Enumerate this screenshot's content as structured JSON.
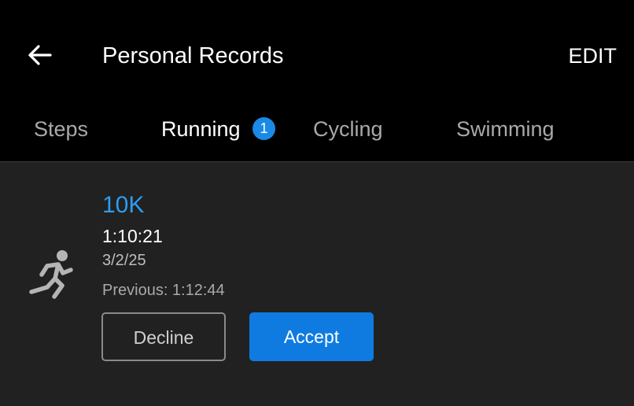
{
  "header": {
    "back_icon": "arrow-left-icon",
    "title": "Personal Records",
    "edit_label": "EDIT"
  },
  "tabs": [
    {
      "label": "Steps",
      "active": false
    },
    {
      "label": "Running",
      "active": true,
      "badge": "1"
    },
    {
      "label": "Cycling",
      "active": false
    },
    {
      "label": "Swimming",
      "active": false
    }
  ],
  "record": {
    "icon": "running-person-icon",
    "name": "10K",
    "time": "1:10:21",
    "date": "3/2/25",
    "previous": "Previous: 1:12:44"
  },
  "actions": {
    "decline_label": "Decline",
    "accept_label": "Accept"
  },
  "colors": {
    "accent": "#0f7be0",
    "record_name": "#2d9cf0",
    "badge": "#1a8ae6",
    "background": "#000000",
    "card": "#212121"
  }
}
